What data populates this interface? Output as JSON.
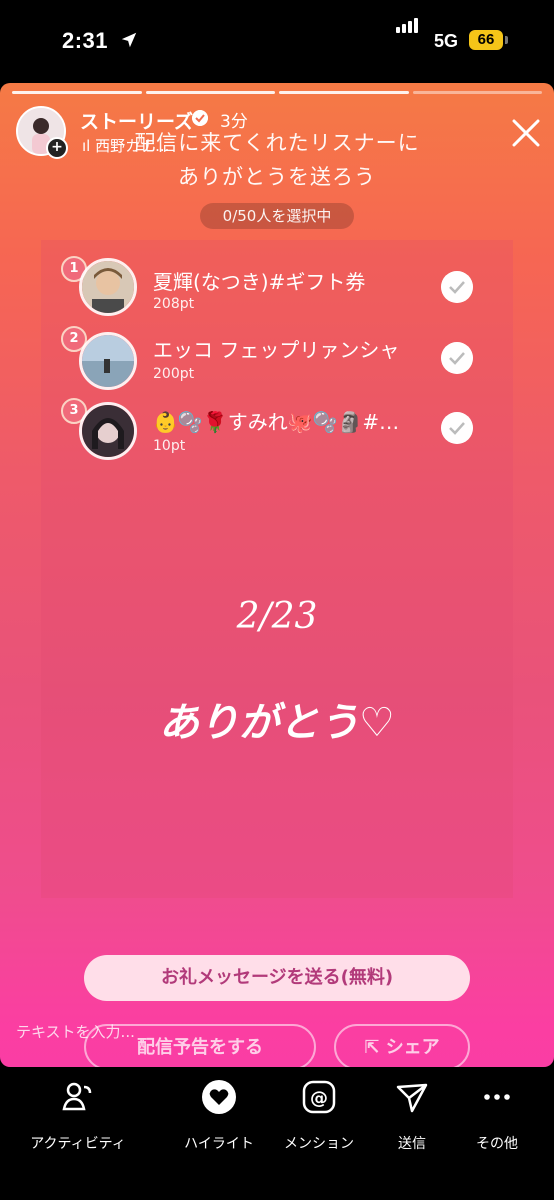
{
  "status": {
    "time": "2:31",
    "network": "5G",
    "battery": "66"
  },
  "story": {
    "user": "ストーリーズ",
    "age": "3分",
    "music": "西野カナ...",
    "header_line1": "配信に来てくれたリスナーに",
    "header_line2": "ありがとうを送ろう",
    "selected_count": "0/50人を選択中",
    "listeners": [
      {
        "rank": "1",
        "name": "夏輝(なつき)#ギフト券",
        "points": "208pt"
      },
      {
        "rank": "2",
        "name": "エッコ フェップリァンシャ",
        "points": "200pt"
      },
      {
        "rank": "3",
        "name": "👶🫧🌹すみれ🐙🫧🗿#…",
        "points": "10pt"
      }
    ],
    "date": "2/23",
    "thanks": "ありがとう♡",
    "primary_button": "お礼メッセージを送る(無料)",
    "schedule_button": "配信予告をする",
    "share_button": "シェア",
    "text_placeholder": "テキストを入力..."
  },
  "bottom_nav": [
    {
      "label": "アクティビティ",
      "icon": "activity-icon"
    },
    {
      "label": "ハイライト",
      "icon": "heart-icon"
    },
    {
      "label": "メンション",
      "icon": "mention-icon"
    },
    {
      "label": "送信",
      "icon": "send-icon"
    },
    {
      "label": "その他",
      "icon": "more-icon"
    }
  ],
  "colors": {
    "accent": "#f06a7a",
    "primary_text": "#b23a7a",
    "battery": "#f5c518"
  }
}
